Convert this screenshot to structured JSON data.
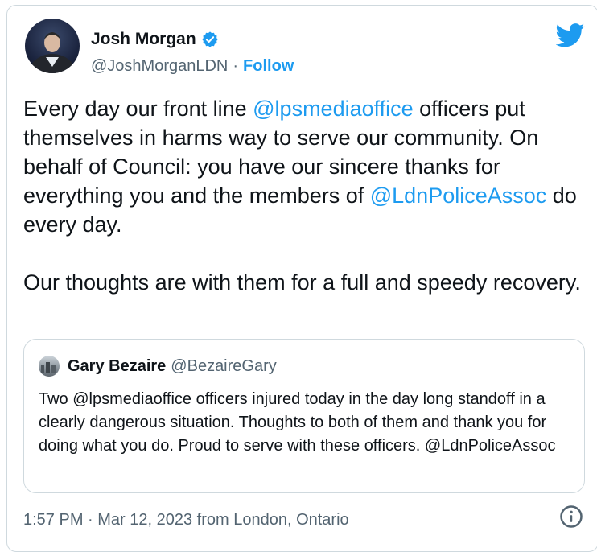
{
  "author": {
    "name": "Josh Morgan",
    "handle": "@JoshMorganLDN",
    "separator": "·",
    "follow_label": "Follow"
  },
  "tweet": {
    "line1_pre": "Every day our front line ",
    "line1_mention": "@lpsmediaoffice",
    "line1_post": " officers put themselves in harms way to serve our community. On behalf of Council: you have our sincere thanks for everything you and the members of ",
    "mention2": "@LdnPoliceAssoc",
    "line2_post": " do every day.",
    "paragraph2": "Our thoughts are with them for a full and speedy recovery."
  },
  "quote": {
    "name": "Gary Bezaire",
    "handle": "@BezaireGary",
    "text": "Two @lpsmediaoffice officers  injured today in the day long standoff in a clearly dangerous situation.  Thoughts to both of them and thank you for doing what you do.  Proud to serve with these officers.  @LdnPoliceAssoc"
  },
  "footer": {
    "timestamp": "1:57 PM · Mar 12, 2023 from London, Ontario"
  },
  "icons": {
    "verified": "verified-badge-icon",
    "brand": "twitter-bird-icon",
    "info": "info-icon"
  },
  "colors": {
    "accent": "#1d9bf0",
    "text": "#0f1419",
    "muted": "#536471",
    "border": "#cfd9de"
  }
}
